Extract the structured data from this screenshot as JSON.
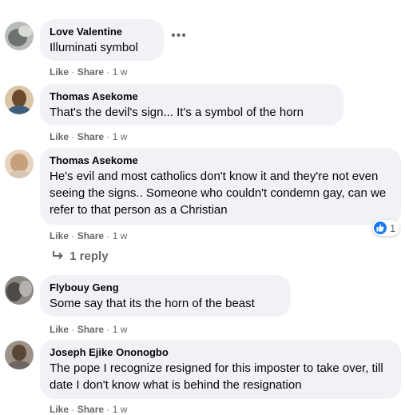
{
  "comments": [
    {
      "author": "Love Valentine",
      "text": "Illuminati symbol",
      "like": "Like",
      "share": "Share",
      "time": "1 w",
      "avatar_color": "#8a8f8a"
    },
    {
      "author": "Thomas Asekome",
      "text": "That's the devil's sign... It's a symbol of the horn",
      "like": "Like",
      "share": "Share",
      "time": "1 w",
      "avatar_color": "#a08a6a"
    },
    {
      "author": "Thomas Asekome",
      "text": "He's evil and most catholics don't know it and they're not even seeing the signs.. Someone who couldn't condemn gay, can we refer to that person as a Christian",
      "like": "Like",
      "share": "Share",
      "time": "1 w",
      "avatar_color": "#c9a88a",
      "reactions_count": "1",
      "replies_label": "1 reply"
    },
    {
      "author": "Flybouy Geng",
      "text": "Some say that its the horn of the beast",
      "like": "Like",
      "share": "Share",
      "time": "1 w",
      "avatar_color": "#6f6a66"
    },
    {
      "author": "Joseph Ejike Ononogbo",
      "text": "The pope I recognize resigned for this imposter to take over, till date I don't know what is behind the resignation",
      "like": "Like",
      "share": "Share",
      "time": "1 w",
      "avatar_color": "#7d7268"
    }
  ],
  "colors": {
    "bubble": "#f0f2f5",
    "meta_text": "#65676b",
    "like_blue": "#1877f2"
  },
  "icons": {
    "more": "more-options-icon",
    "reply_arrow": "reply-arrow-icon",
    "like_reaction": "thumbs-up-icon"
  }
}
